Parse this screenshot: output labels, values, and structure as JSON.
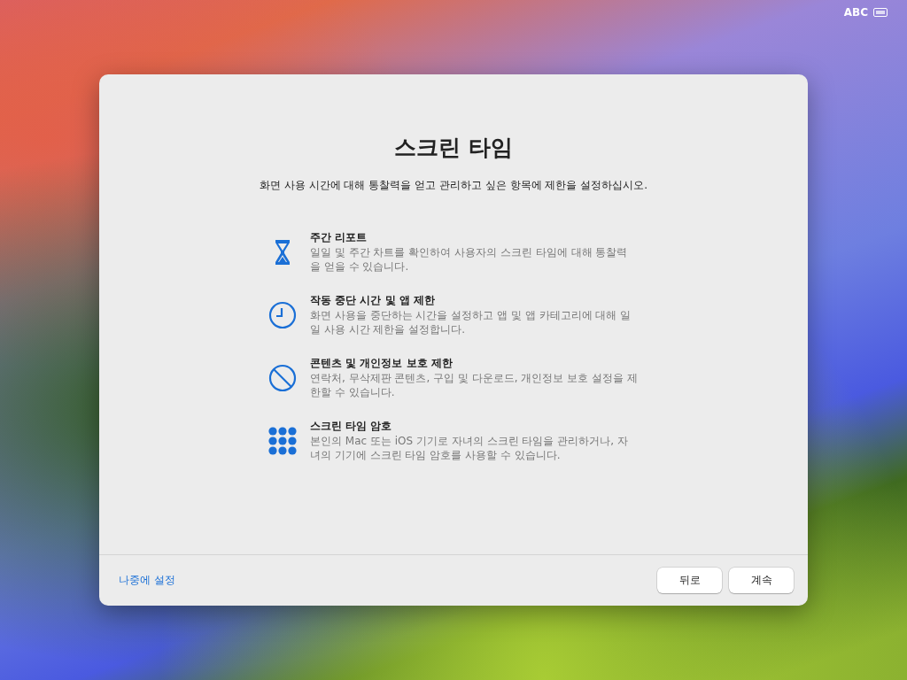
{
  "menu_bar": {
    "input_source": "ABC"
  },
  "dialog": {
    "title": "스크린 타임",
    "subtitle": "화면 사용 시간에 대해 통찰력을 얻고 관리하고 싶은 항목에 제한을 설정하십시오.",
    "features": [
      {
        "kind": "hourglass",
        "title": "주간 리포트",
        "description": "일일 및 주간 차트를 확인하여 사용자의 스크린 타임에 대해 통찰력을 얻을 수 있습니다."
      },
      {
        "kind": "clock",
        "title": "작동 중단 시간 및 앱 제한",
        "description": "화면 사용을 중단하는 시간을 설정하고 앱 및 앱 카테고리에 대해 일일 사용 시간 제한을 설정합니다."
      },
      {
        "kind": "prohibit",
        "title": "콘텐츠 및 개인정보 보호 제한",
        "description": "연락처, 무삭제판 콘텐츠, 구입 및 다운로드, 개인정보 보호 설정을 제한할 수 있습니다."
      },
      {
        "kind": "keypad",
        "title": "스크린 타임 암호",
        "description": "본인의 Mac 또는 iOS 기기로 자녀의 스크린 타임을 관리하거나, 자녀의 기기에 스크린 타임 암호를 사용할 수 있습니다."
      }
    ],
    "later_link": "나중에 설정",
    "buttons": [
      "뒤로",
      "계속"
    ]
  }
}
